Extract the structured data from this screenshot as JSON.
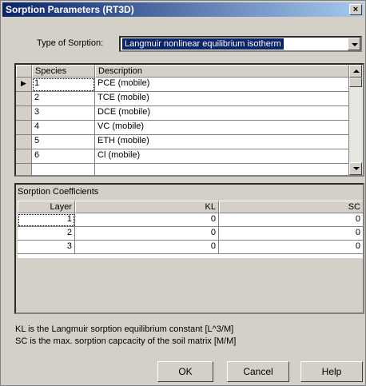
{
  "window": {
    "title": "Sorption Parameters (RT3D)",
    "close_label": "×"
  },
  "sorption": {
    "label": "Type of Sorption:",
    "selected": "Langmuir nonlinear equilibrium isotherm"
  },
  "species_table": {
    "headers": [
      "Species",
      "Description"
    ],
    "rows": [
      {
        "species": "1",
        "description": "PCE (mobile)"
      },
      {
        "species": "2",
        "description": "TCE (mobile)"
      },
      {
        "species": "3",
        "description": "DCE (mobile)"
      },
      {
        "species": "4",
        "description": "VC (mobile)"
      },
      {
        "species": "5",
        "description": "ETH (mobile)"
      },
      {
        "species": "6",
        "description": "Cl (mobile)"
      }
    ],
    "current_row_marker": "▶"
  },
  "coefficients": {
    "title": "Sorption Coefficients",
    "headers": [
      "Layer",
      "KL",
      "SC"
    ],
    "rows": [
      {
        "layer": "1",
        "kl": "0",
        "sc": "0"
      },
      {
        "layer": "2",
        "kl": "0",
        "sc": "0"
      },
      {
        "layer": "3",
        "kl": "0",
        "sc": "0"
      }
    ]
  },
  "notes": {
    "kl": "KL is the Langmuir sorption equilibrium constant [L^3/M]",
    "sc": "SC is the max. sorption capcacity of the soil matrix [M/M]"
  },
  "buttons": {
    "ok": "OK",
    "cancel": "Cancel",
    "help": "Help"
  },
  "colors": {
    "titlebar": "#0a246a",
    "face": "#d4d0c8",
    "selection": "#0a246a"
  }
}
